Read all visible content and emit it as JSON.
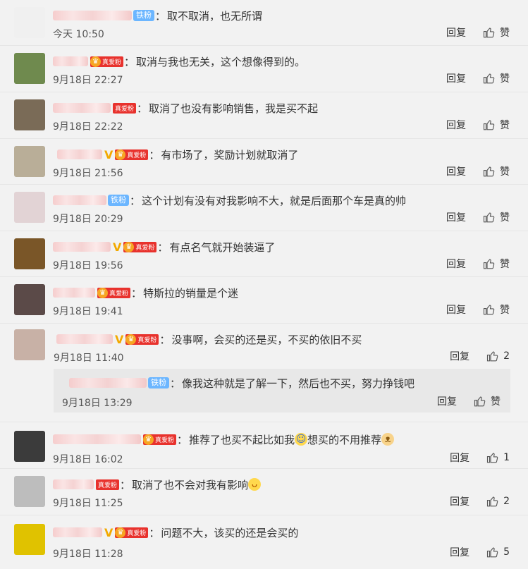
{
  "comments": [
    {
      "badge": "iron",
      "text": "取不取消，也无所谓",
      "time": "今天 10:50",
      "reply": "回复",
      "like": "赞",
      "avatarColor": "#f0f0f0"
    },
    {
      "badge": "fan",
      "text": "取消与我也无关，这个想像得到的。",
      "time": "9月18日 22:27",
      "reply": "回复",
      "like": "赞",
      "avatarColor": "#6f8a4e"
    },
    {
      "badge": "fan-plain",
      "text": "取消了也没有影响销售，我是买不起",
      "time": "9月18日 22:22",
      "reply": "回复",
      "like": "赞",
      "avatarColor": "#7a6b57"
    },
    {
      "badge": "fan-v",
      "text": "有市场了，奖励计划就取消了",
      "time": "9月18日 21:56",
      "reply": "回复",
      "like": "赞",
      "avatarColor": "#b9ae98"
    },
    {
      "badge": "iron",
      "text": "这个计划有没有对我影响不大，就是后面那个车是真的帅",
      "time": "9月18日 20:29",
      "reply": "回复",
      "like": "赞",
      "avatarColor": "#e2d3d5"
    },
    {
      "badge": "fan-v",
      "text": "有点名气就开始装逼了",
      "time": "9月18日 19:56",
      "reply": "回复",
      "like": "赞",
      "avatarColor": "#7a5628"
    },
    {
      "badge": "fan",
      "text": "特斯拉的销量是个迷",
      "time": "9月18日 19:41",
      "reply": "回复",
      "like": "赞",
      "avatarColor": "#5b4a48"
    },
    {
      "badge": "fan-v",
      "text": "没事啊，会买的还是买，不买的依旧不买",
      "time": "9月18日 11:40",
      "reply": "回复",
      "like": "2",
      "avatarColor": "#c8b1a6"
    },
    {
      "badge": "fan",
      "text": "推荐了也买不起比如我",
      "textAfter": "想买的不用推荐",
      "emoji1": "cry",
      "emoji2": "dog",
      "time": "9月18日 16:02",
      "reply": "回复",
      "like": "1",
      "avatarColor": "#3b3b3b"
    },
    {
      "badge": "fan-plain",
      "text": "取消了也不会对我有影响",
      "emoji1": "laugh",
      "time": "9月18日 11:25",
      "reply": "回复",
      "like": "2",
      "avatarColor": "#bdbdbd"
    },
    {
      "badge": "fan-v",
      "text": "问题不大，该买的还是会买的",
      "time": "9月18日 11:28",
      "reply": "回复",
      "like": "5",
      "avatarColor": "#e0c200"
    }
  ],
  "subReply": {
    "badge": "铁粉",
    "text": "像我这种就是了解一下，然后也不买，努力挣钱吧",
    "time": "9月18日 13:29",
    "reply": "回复",
    "like": "赞"
  },
  "labels": {
    "iron": "铁粉",
    "fan": "真爱粉",
    "colon": "：",
    "vmark": "V",
    "crown": "♛"
  },
  "colors": {
    "ironBadge": "#6cb6ff",
    "fanBadge": "#e8322d",
    "crown": "#f6a623"
  }
}
